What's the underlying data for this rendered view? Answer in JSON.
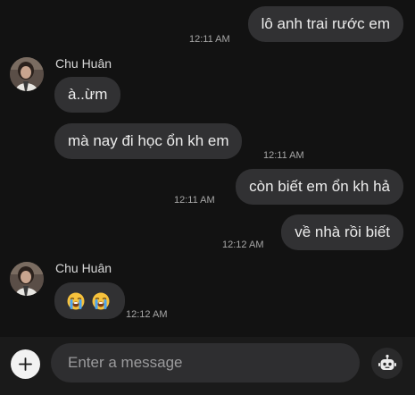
{
  "messages": [
    {
      "text": "lô anh trai rước em",
      "time": "12:11 AM"
    },
    {
      "sender": "Chu Huân",
      "text": "à..ừm"
    },
    {
      "text": "mà nay đi học ổn kh em",
      "time": "12:11 AM"
    },
    {
      "text": "còn biết em ổn kh hả",
      "time": "12:11 AM"
    },
    {
      "text": "về nhà rồi biết",
      "time": "12:12 AM"
    },
    {
      "sender": "Chu Huân",
      "emoji": [
        "loudly-crying-face",
        "loudly-crying-face"
      ],
      "time": "12:12 AM"
    }
  ],
  "composer": {
    "placeholder": "Enter a message",
    "left_icon": "plus-icon",
    "right_icon": "robot-icon"
  },
  "colors": {
    "background": "#121212",
    "bubble": "#313133",
    "composer_bar": "#1a1a1a",
    "input": "#2e2e30",
    "emoji_yellow": "#f7c23c",
    "tears_blue": "#4aa3f0"
  }
}
